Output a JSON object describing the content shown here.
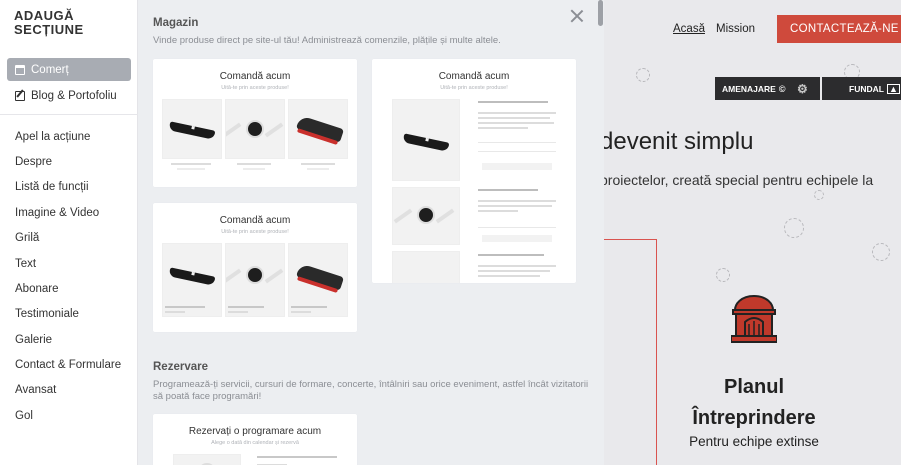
{
  "sidebar": {
    "title": "ADAUGĂ SECȚIUNE",
    "active_items": [
      {
        "label": "Comerț",
        "icon": "store-icon"
      },
      {
        "label": "Blog & Portofoliu",
        "icon": "pen-icon"
      }
    ],
    "items": [
      "Apel la acțiune",
      "Despre",
      "Listă de funcții",
      "Imagine & Video",
      "Grilă",
      "Text",
      "Abonare",
      "Testimoniale",
      "Galerie",
      "Contact & Formulare",
      "Avansat",
      "Gol"
    ]
  },
  "panel": {
    "shop": {
      "title": "Magazin",
      "description": "Vinde produse direct pe site-ul tău! Administrează comenzile, plățile și multe altele.",
      "card_title": "Comandă acum",
      "card_subtitle": "Uită-te prin aceste produse!"
    },
    "booking": {
      "title": "Rezervare",
      "description": "Programează-ți servicii, cursuri de formare, concerte, întâlniri sau orice eveniment, astfel încât vizitatorii să poată face programări!",
      "card_title": "Rezervați o programare acum",
      "card_subtitle": "Alege o dată din calendar și rezervă"
    }
  },
  "preview": {
    "nav": {
      "home": "Acasă",
      "mission": "Mission",
      "contact": "CONTACTEAZĂ-NE"
    },
    "toolbar": {
      "layout": "AMENAJARE",
      "layout_icon": "copyright-icon",
      "settings_icon": "gear-icon",
      "background": "FUNDAL",
      "background_icon": "image-icon"
    },
    "hero": {
      "heading": "devenit simplu",
      "subheading": "proiectelor, creată special pentru echipele la"
    },
    "plan": {
      "title": "Planul Întreprindere",
      "subtitle": "Pentru echipe extinse"
    },
    "colors": {
      "accent": "#cf4a3c",
      "dark": "#2c2c2e"
    }
  }
}
